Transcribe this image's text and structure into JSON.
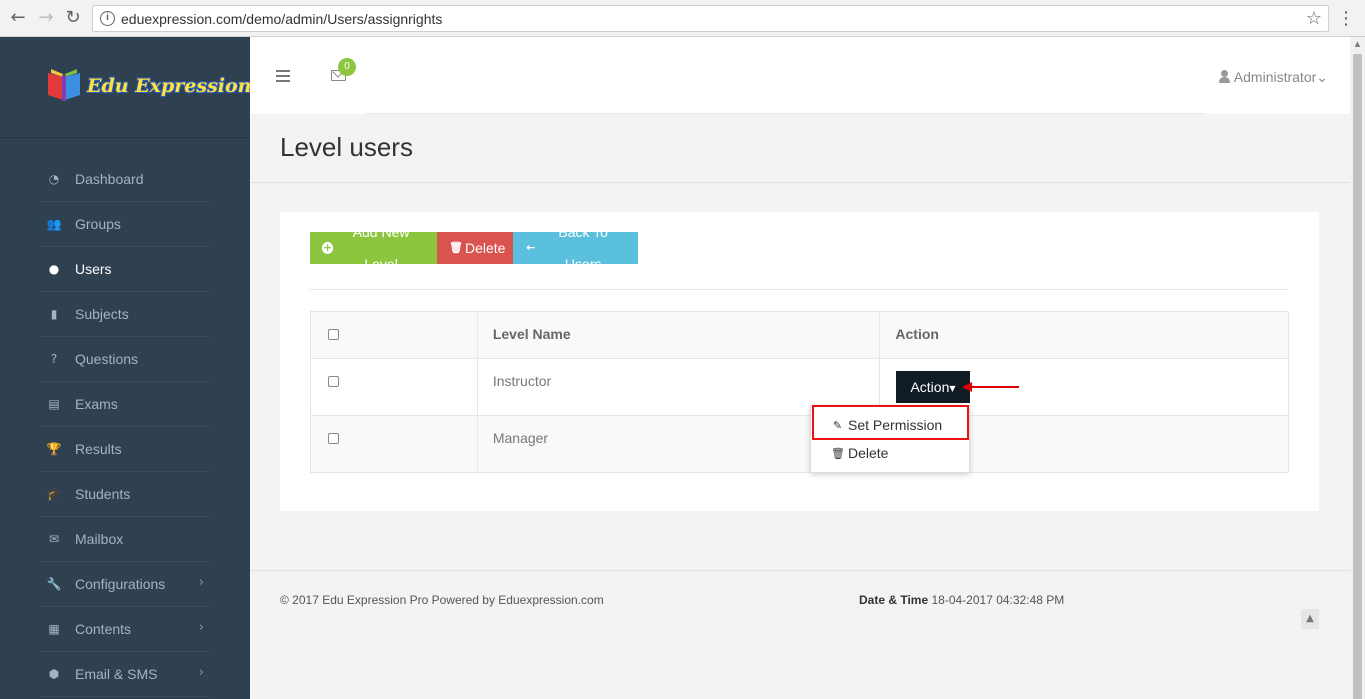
{
  "browser": {
    "url": "eduexpression.com/demo/admin/Users/assignrights"
  },
  "brand": {
    "logo_text": "Edu Expression"
  },
  "sidebar": {
    "items": [
      {
        "label": "Dashboard",
        "icon": "dashboard-icon",
        "glyph": "◔"
      },
      {
        "label": "Groups",
        "icon": "users-icon",
        "glyph": "👥"
      },
      {
        "label": "Users",
        "icon": "user-icon",
        "glyph": "●",
        "active": true
      },
      {
        "label": "Subjects",
        "icon": "book-icon",
        "glyph": "▮"
      },
      {
        "label": "Questions",
        "icon": "question-icon",
        "glyph": "?"
      },
      {
        "label": "Exams",
        "icon": "list-icon",
        "glyph": "▤"
      },
      {
        "label": "Results",
        "icon": "trophy-icon",
        "glyph": "🏆"
      },
      {
        "label": "Students",
        "icon": "graduation-cap-icon",
        "glyph": "🎓"
      },
      {
        "label": "Mailbox",
        "icon": "envelope-icon",
        "glyph": "✉"
      },
      {
        "label": "Configurations",
        "icon": "wrench-icon",
        "glyph": "🔧",
        "chevron": "›"
      },
      {
        "label": "Contents",
        "icon": "newspaper-icon",
        "glyph": "▦",
        "chevron": "›"
      },
      {
        "label": "Email & SMS",
        "icon": "shield-icon",
        "glyph": "⬢",
        "chevron": "›"
      }
    ]
  },
  "header": {
    "mail_count": "0",
    "user_label": "Administrator",
    "user_caret": "⌄"
  },
  "page": {
    "title": "Level users"
  },
  "toolbar": {
    "add_label": "Add New Level",
    "delete_label": "Delete",
    "back_label": "Back To Users"
  },
  "table": {
    "headers": [
      "",
      "Level Name",
      "Action"
    ],
    "rows": [
      {
        "name": "Instructor"
      },
      {
        "name": "Manager"
      }
    ]
  },
  "action_menu": {
    "button_label": "Action",
    "items": [
      {
        "label": "Set Permission",
        "icon": "edit-icon"
      },
      {
        "label": "Delete",
        "icon": "trash-icon"
      }
    ]
  },
  "footer": {
    "copyright": "© 2017 Edu Expression Pro Powered by Eduexpression.com",
    "date_label": "Date & Time",
    "date_value": "18-04-2017 04:32:48 PM"
  },
  "colors": {
    "sidebar_bg": "#2f4050",
    "green": "#8cc63f",
    "red": "#d9534f",
    "blue": "#5bc0de",
    "action_bg": "#111b24",
    "annotation_red": "#dd0000"
  }
}
